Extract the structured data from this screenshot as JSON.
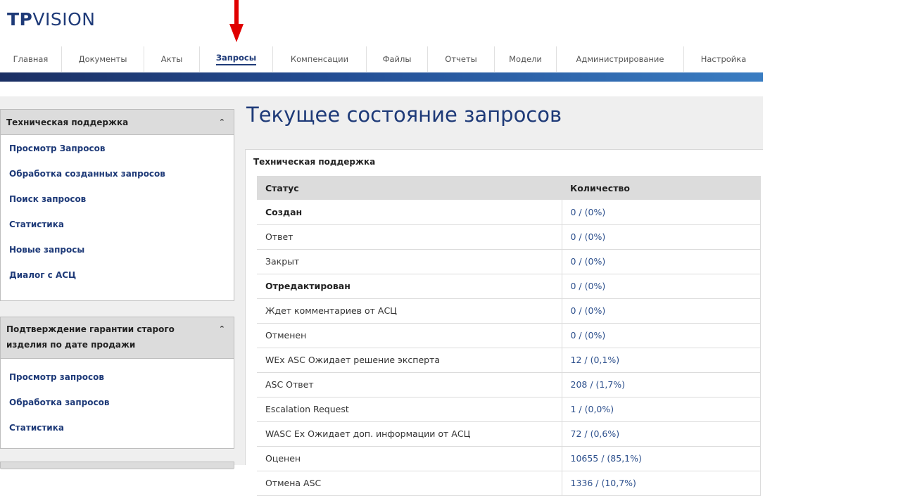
{
  "logo": {
    "part1": "TP",
    "part2": "VISION"
  },
  "nav": [
    {
      "label": "Главная"
    },
    {
      "label": "Документы"
    },
    {
      "label": "Акты"
    },
    {
      "label": "Запросы",
      "active": true
    },
    {
      "label": "Компенсации"
    },
    {
      "label": "Файлы"
    },
    {
      "label": "Отчеты"
    },
    {
      "label": "Модели"
    },
    {
      "label": "Администрирование"
    },
    {
      "label": "Настройка"
    }
  ],
  "sidebar": {
    "panel1": {
      "title": "Техническая поддержка",
      "links": [
        "Просмотр Запросов",
        "Обработка созданных запросов",
        "Поиск запросов",
        "Статистика",
        "Новые запросы",
        "Диалог с АСЦ"
      ]
    },
    "panel2": {
      "title_line1": "Подтверждение гарантии старого",
      "title_line2": "изделия по дате продажи",
      "links": [
        "Просмотр запросов",
        "Обработка запросов",
        "Статистика"
      ]
    }
  },
  "main": {
    "title": "Текущее состояние запросов",
    "section_title": "Техническая поддержка",
    "columns": [
      "Статус",
      "Количество"
    ],
    "rows": [
      {
        "status": "Создан",
        "count": "0 / (0%)"
      },
      {
        "status": "Ответ",
        "count": "0 / (0%)"
      },
      {
        "status": "Закрыт",
        "count": "0 / (0%)"
      },
      {
        "status": "Отредактирован",
        "count": "0 / (0%)"
      },
      {
        "status": "Ждет комментариев от АСЦ",
        "count": "0 / (0%)"
      },
      {
        "status": "Отменен",
        "count": "0 / (0%)"
      },
      {
        "status": "WEx ASC Ожидает решение эксперта",
        "count": "12 / (0,1%)"
      },
      {
        "status": "ASC Ответ",
        "count": "208 / (1,7%)"
      },
      {
        "status": "Escalation Request",
        "count": "1 / (0,0%)"
      },
      {
        "status": "WASC Ex Ожидает доп. информации от АСЦ",
        "count": "72 / (0,6%)"
      },
      {
        "status": "Оценен",
        "count": "10655 / (85,1%)"
      },
      {
        "status": "Отмена ASC",
        "count": "1336 / (10,7%)"
      }
    ]
  },
  "colors": {
    "brand": "#1e3a78",
    "link": "#1e3a78",
    "annotation_arrow": "#e00000"
  }
}
